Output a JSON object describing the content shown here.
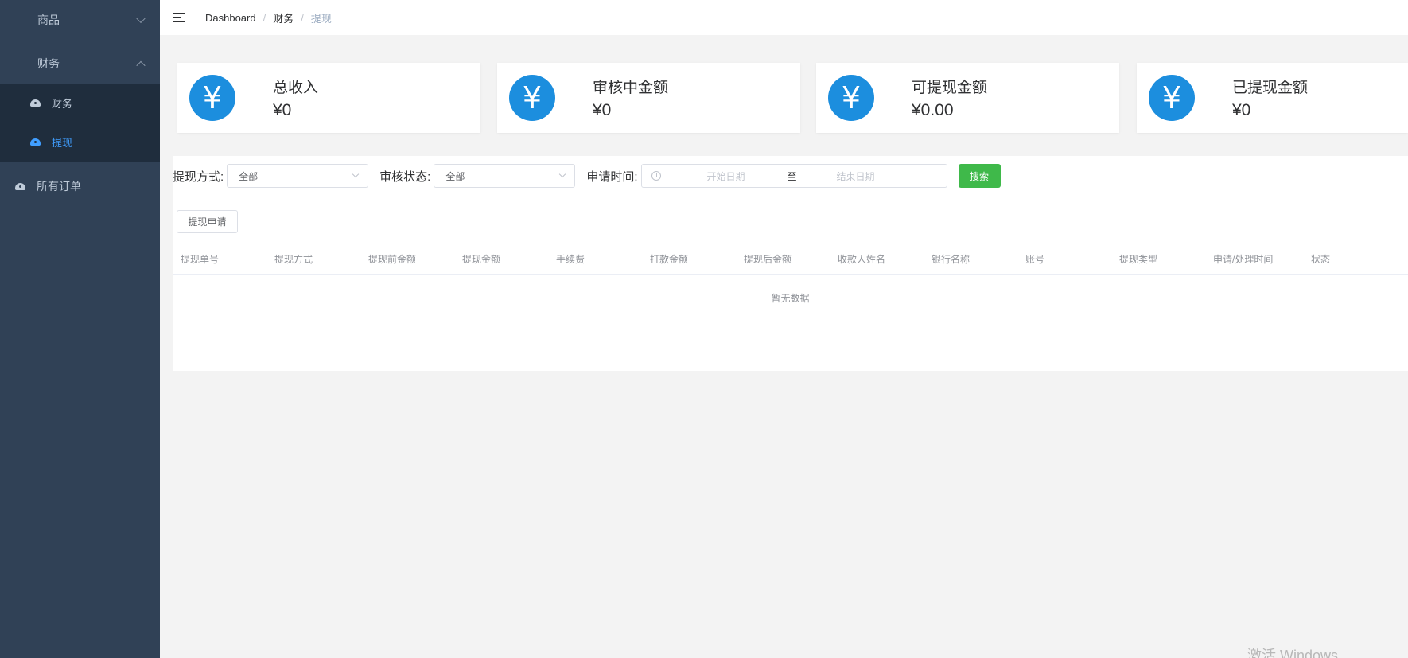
{
  "sidebar": {
    "items": [
      {
        "label": "商品"
      },
      {
        "label": "财务"
      }
    ],
    "finance_submenu": [
      {
        "label": "财务"
      },
      {
        "label": "提现"
      }
    ],
    "orders": {
      "label": "所有订单"
    }
  },
  "header": {
    "breadcrumb": [
      "Dashboard",
      "财务",
      "提现"
    ]
  },
  "stats": [
    {
      "label": "总收入",
      "value": "¥0"
    },
    {
      "label": "审核中金额",
      "value": "¥0"
    },
    {
      "label": "可提现金额",
      "value": "¥0.00"
    },
    {
      "label": "已提现金额",
      "value": "¥0"
    }
  ],
  "stat_icon": "¥",
  "filters": {
    "method_label": "提现方式:",
    "method_value": "全部",
    "status_label": "审核状态:",
    "status_value": "全部",
    "time_label": "申请时间:",
    "start_placeholder": "开始日期",
    "range_separator": "至",
    "end_placeholder": "结束日期",
    "search_label": "搜索"
  },
  "apply_button": "提现申请",
  "table": {
    "columns": [
      "提现单号",
      "提现方式",
      "提现前金额",
      "提现金额",
      "手续费",
      "打款金额",
      "提现后金额",
      "收款人姓名",
      "银行名称",
      "账号",
      "提现类型",
      "申请/处理时间",
      "状态"
    ],
    "empty_text": "暂无数据"
  },
  "watermark": "激活 Windows",
  "colors": {
    "sidebar_bg": "#304156",
    "submenu_bg": "#1f2d3d",
    "active": "#409eff",
    "stat_icon_bg": "#1c8ede",
    "search_button": "#3fb94a"
  }
}
